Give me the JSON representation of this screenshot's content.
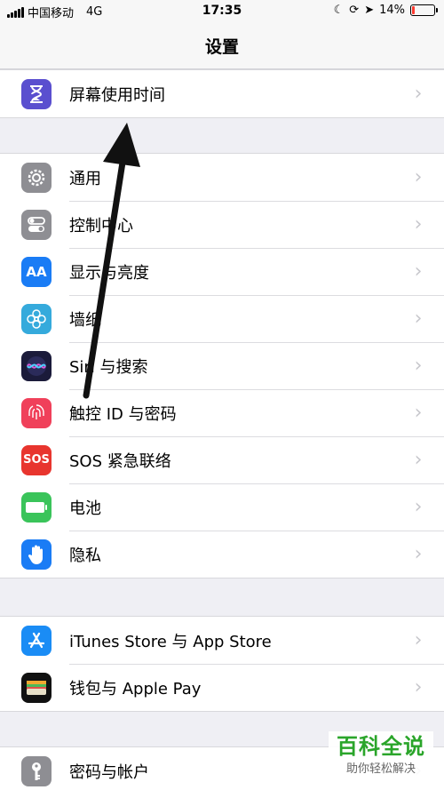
{
  "status_bar": {
    "carrier": "中国移动",
    "network": "4G",
    "time": "17:35",
    "battery_percent": "14%",
    "battery_level": 0.14
  },
  "nav": {
    "title": "设置"
  },
  "groups": [
    {
      "items": [
        {
          "label": "屏幕使用时间",
          "icon": "hourglass-icon",
          "color": "#5a4fcf"
        }
      ]
    },
    {
      "items": [
        {
          "label": "通用",
          "icon": "gear-icon",
          "color": "#8e8e93"
        },
        {
          "label": "控制中心",
          "icon": "toggles-icon",
          "color": "#8e8e93"
        },
        {
          "label": "显示与亮度",
          "icon": "text-size-icon",
          "icon_text": "AA",
          "color": "#1a7cf5"
        },
        {
          "label": "墙纸",
          "icon": "flower-icon",
          "color": "#35aadc"
        },
        {
          "label": "Siri 与搜索",
          "icon": "siri-icon",
          "color": "#1b1b3a"
        },
        {
          "label": "触控 ID 与密码",
          "icon": "fingerprint-icon",
          "color": "#f0405a"
        },
        {
          "label": "SOS 紧急联络",
          "icon": "sos-icon",
          "icon_text": "SOS",
          "color": "#e8352e"
        },
        {
          "label": "电池",
          "icon": "battery-icon",
          "color": "#3ac45a"
        },
        {
          "label": "隐私",
          "icon": "hand-icon",
          "color": "#1a7cf5"
        }
      ]
    },
    {
      "items": [
        {
          "label": "iTunes Store 与 App Store",
          "icon": "app-store-icon",
          "color": "#1a8cf5"
        },
        {
          "label": "钱包与 Apple Pay",
          "icon": "wallet-icon",
          "color": "#111111"
        }
      ]
    },
    {
      "items": [
        {
          "label": "密码与帐户",
          "icon": "key-icon",
          "color": "#8e8e93"
        }
      ]
    }
  ],
  "watermark": {
    "title": "百科全说",
    "subtitle": "助你轻松解决"
  }
}
